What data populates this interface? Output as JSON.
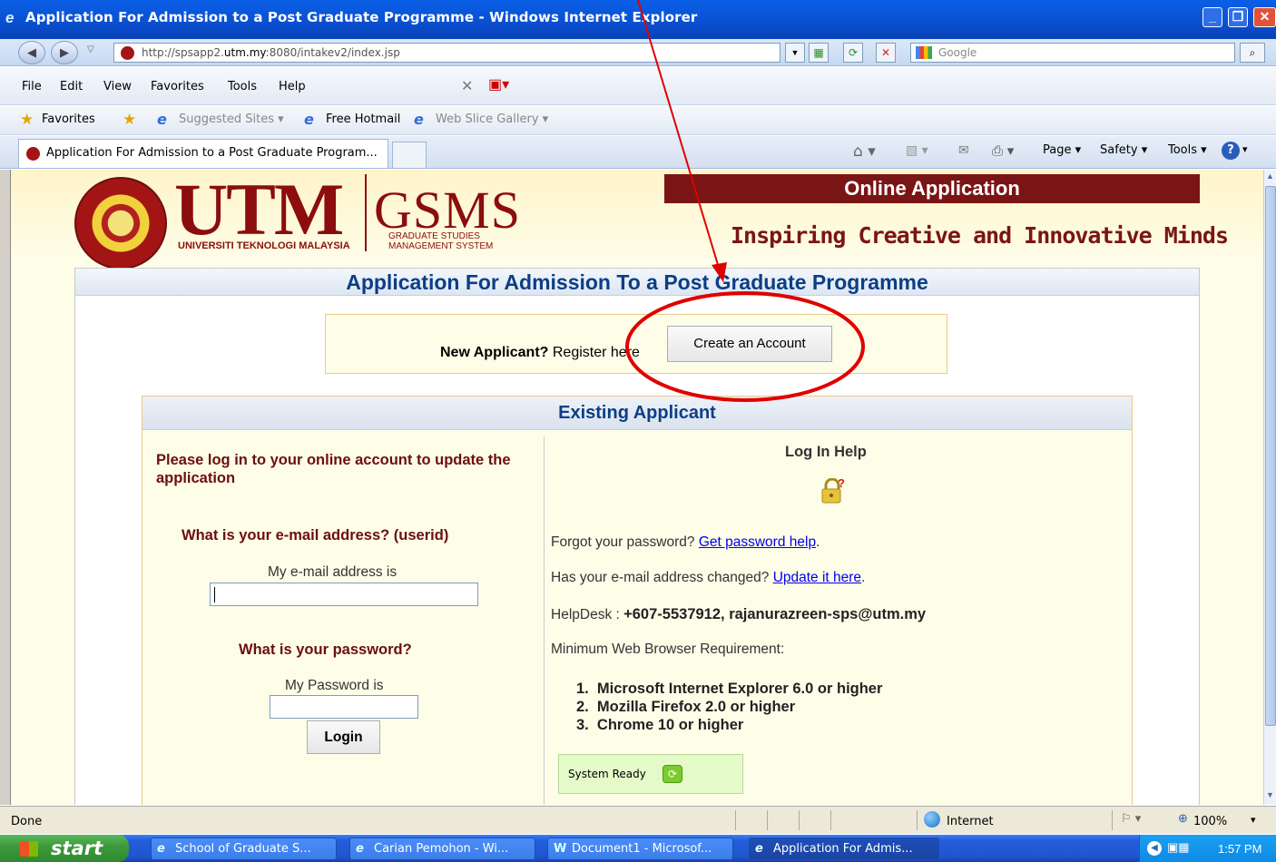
{
  "window": {
    "title": "Application For Admission to a Post Graduate Programme - Windows Internet Explorer"
  },
  "address": {
    "url_prefix": "http://spsapp2.",
    "url_domain": "utm.my",
    "url_suffix": ":8080/intakev2/index.jsp",
    "search_placeholder": "Google"
  },
  "menu": [
    "File",
    "Edit",
    "View",
    "Favorites",
    "Tools",
    "Help"
  ],
  "favorites_bar": {
    "favorites_label": "Favorites",
    "items": [
      "Suggested Sites ▾",
      "Free Hotmail",
      "Web Slice Gallery ▾"
    ]
  },
  "tab": {
    "active_title": "Application For Admission to a Post Graduate Program...",
    "command_items": [
      "Page ▾",
      "Safety ▾",
      "Tools ▾"
    ]
  },
  "banner": {
    "online_application": "Online Application",
    "tagline": "Inspiring Creative and Innovative Minds",
    "utm": "UTM",
    "utm_sub": "UNIVERSITI TEKNOLOGI MALAYSIA",
    "gsms": "GSMS",
    "gsms_sub1": "GRADUATE STUDIES",
    "gsms_sub2": "MANAGEMENT SYSTEM"
  },
  "main": {
    "header": "Application For Admission To a Post Graduate Programme",
    "new_applicant_bold": "New Applicant?",
    "new_applicant_rest": " Register here",
    "create_account": "Create an Account",
    "existing_header": "Existing Applicant",
    "please_log_in": "Please log in to your online account to update the application",
    "email_question": "What is your e-mail address? (userid)",
    "email_label": "My e-mail address is",
    "password_question": "What is your password?",
    "password_label": "My Password is",
    "login_button": "Login"
  },
  "help": {
    "title": "Log In Help",
    "forgot_text": "Forgot your password? ",
    "forgot_link": "Get password help",
    "changed_text": "Has your e-mail address changed? ",
    "changed_link": "Update it here",
    "helpdesk_label": "HelpDesk : ",
    "helpdesk_value": "+607-5537912, rajanurazreen-sps@utm.my",
    "min_req": "Minimum Web Browser Requirement:",
    "requirements": [
      "1.  Microsoft Internet Explorer 6.0 or higher",
      "2.  Mozilla Firefox 2.0 or higher",
      "3.  Chrome 10 or higher"
    ],
    "system_ready": "System Ready"
  },
  "status": {
    "left": "Done",
    "zone": "Internet",
    "zoom": "100%"
  },
  "taskbar": {
    "start": "start",
    "items": [
      "School of Graduate S...",
      "Carian Pemohon - Wi...",
      "Document1 - Microsof...",
      "Application For Admis..."
    ],
    "clock": "1:57 PM"
  },
  "colors": {
    "brand_maroon": "#7a1515",
    "header_blue": "#0c3e86",
    "annotation_red": "#e00000"
  }
}
